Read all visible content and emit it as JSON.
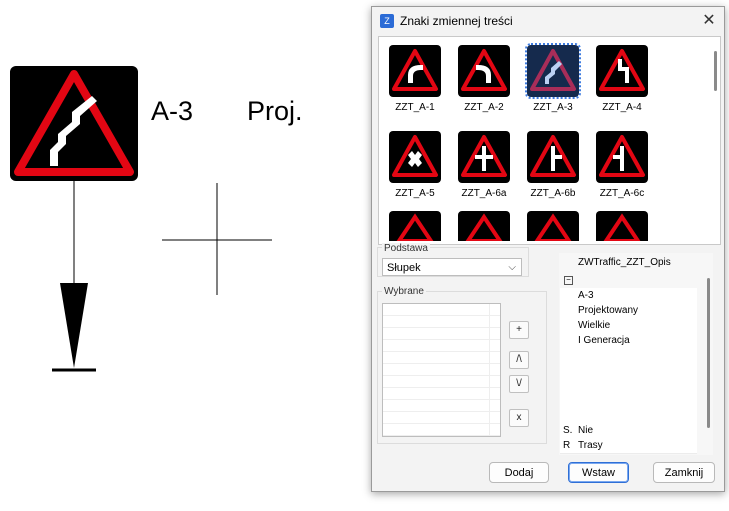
{
  "canvas": {
    "sign_code": "A-3",
    "status": "Proj."
  },
  "dialog": {
    "title": "Znaki zmiennej treści",
    "close": "✕",
    "signs": [
      {
        "label": "ZZT_A-1",
        "glyph": "curve-left"
      },
      {
        "label": "ZZT_A-2",
        "glyph": "curve-right"
      },
      {
        "label": "ZZT_A-3",
        "glyph": "double-curve",
        "selected": true
      },
      {
        "label": "ZZT_A-4",
        "glyph": "double-curve-alt"
      },
      {
        "label": "ZZT_A-5",
        "glyph": "cross"
      },
      {
        "label": "ZZT_A-6a",
        "glyph": "cross-road"
      },
      {
        "label": "ZZT_A-6b",
        "glyph": "tee-right"
      },
      {
        "label": "ZZT_A-6c",
        "glyph": "tee-left"
      }
    ],
    "base": {
      "label": "Podstawa",
      "value": "Słupek"
    },
    "selected_group": {
      "label": "Wybrane",
      "buttons": [
        "+",
        "/\\",
        "\\/",
        "x"
      ]
    },
    "properties": {
      "header": "ZWTraffic_ZZT_Opis",
      "collapse": "−",
      "rows": [
        "A-3",
        "Projektowany",
        "Wielkie",
        "I Generacja"
      ],
      "extra": [
        {
          "key": "S.",
          "value": "Nie"
        },
        {
          "key": "R",
          "value": "Trasy"
        }
      ]
    },
    "footer": {
      "add": "Dodaj",
      "insert": "Wstaw",
      "close": "Zamknij"
    }
  },
  "colors": {
    "sign_red": "#e30613",
    "sign_black": "#000000",
    "selection": "#3d7be0"
  }
}
